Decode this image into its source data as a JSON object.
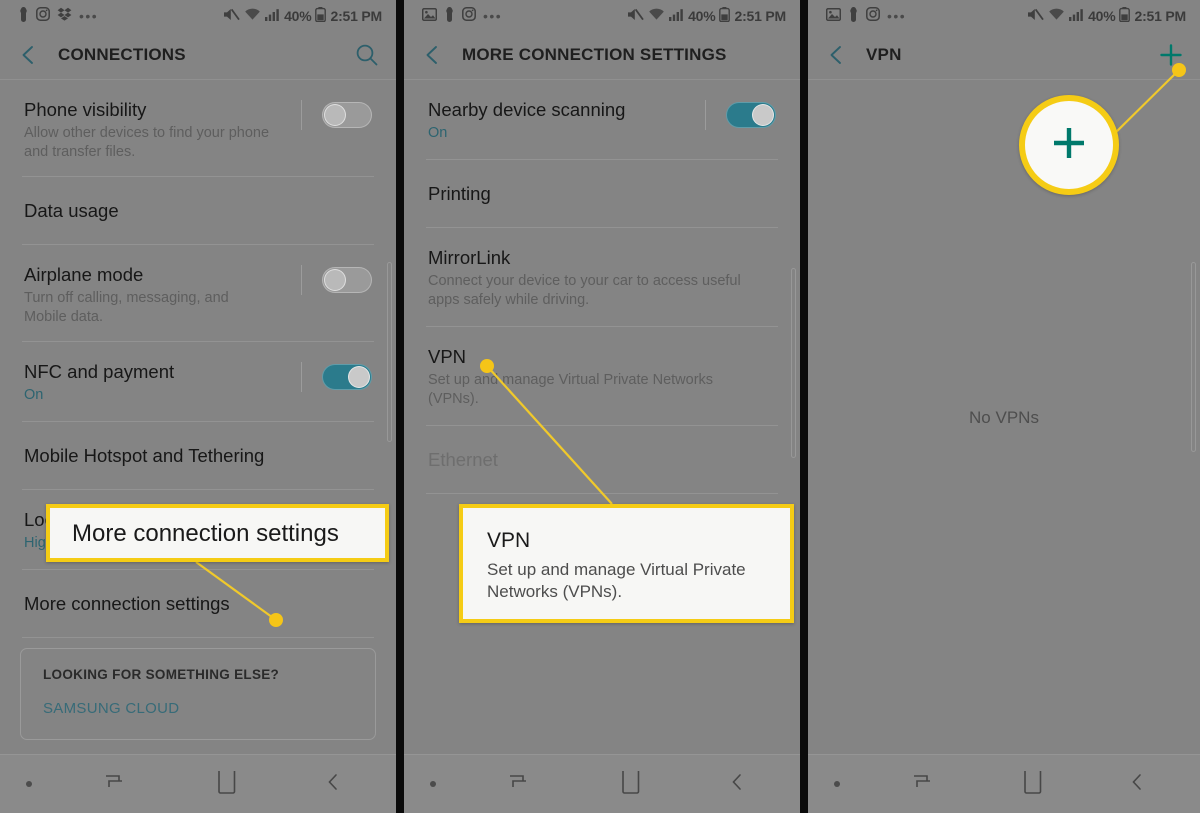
{
  "panels": [
    {
      "id": "connections",
      "statusbar": {
        "left_icons": [
          "image-icon-hidden",
          "keyhole-icon",
          "instagram-icon",
          "dropbox-icon",
          "more-dots-icon"
        ],
        "mute_icon": "mute-icon",
        "wifi_icon": "wifi-icon",
        "signal_icon": "signal-bars-icon",
        "battery_percent": "40%",
        "battery_icon": "battery-icon",
        "time": "2:51 PM"
      },
      "appbar": {
        "back_icon": "chevron-left-icon",
        "title": "CONNECTIONS",
        "action_icon": "search-icon"
      },
      "rows": [
        {
          "title": "Phone visibility",
          "sub": "Allow other devices to find your phone and transfer files.",
          "toggle": "off"
        },
        {
          "title": "Data usage",
          "sub": "",
          "toggle": "none"
        },
        {
          "title": "Airplane mode",
          "sub": "Turn off calling, messaging, and Mobile data.",
          "toggle": "off"
        },
        {
          "title": "NFC and payment",
          "sub": "On",
          "sub_state": "on",
          "toggle": "on"
        },
        {
          "title": "Mobile Hotspot and Tethering",
          "sub": "",
          "toggle": "none"
        },
        {
          "title": "Location",
          "sub": "High accuracy",
          "sub_state": "on",
          "toggle": "none"
        },
        {
          "title": "More connection settings",
          "sub": "",
          "toggle": "none"
        }
      ],
      "footer_card": {
        "title": "LOOKING FOR SOMETHING ELSE?",
        "link": "SAMSUNG CLOUD"
      }
    },
    {
      "id": "more-connection-settings",
      "statusbar": {
        "left_icons": [
          "image-icon",
          "keyhole-icon",
          "instagram-icon",
          "more-dots-icon"
        ],
        "mute_icon": "mute-icon",
        "wifi_icon": "wifi-icon",
        "signal_icon": "signal-bars-icon",
        "battery_percent": "40%",
        "battery_icon": "battery-icon",
        "time": "2:51 PM"
      },
      "appbar": {
        "back_icon": "chevron-left-icon",
        "title": "MORE CONNECTION SETTINGS",
        "action_icon": "none"
      },
      "rows": [
        {
          "title": "Nearby device scanning",
          "sub": "On",
          "sub_state": "on",
          "toggle": "on"
        },
        {
          "title": "Printing",
          "sub": "",
          "toggle": "none"
        },
        {
          "title": "MirrorLink",
          "sub": "Connect your device to your car to access useful apps safely while driving.",
          "toggle": "none"
        },
        {
          "title": "VPN",
          "sub": "Set up and manage Virtual Private Networks (VPNs).",
          "toggle": "none"
        },
        {
          "title": "Ethernet",
          "sub": "",
          "toggle": "none",
          "disabled": true
        }
      ]
    },
    {
      "id": "vpn",
      "statusbar": {
        "left_icons": [
          "image-icon",
          "keyhole-icon",
          "instagram-icon",
          "more-dots-icon"
        ],
        "mute_icon": "mute-icon",
        "wifi_icon": "wifi-icon",
        "signal_icon": "signal-bars-icon",
        "battery_percent": "40%",
        "battery_icon": "battery-icon",
        "time": "2:51 PM"
      },
      "appbar": {
        "back_icon": "chevron-left-icon",
        "title": "VPN",
        "action_icon": "plus-icon"
      },
      "empty_state": "No VPNs"
    }
  ],
  "navbar": {
    "items": [
      "nav-dot-icon",
      "recents-icon",
      "home-icon",
      "back-icon"
    ]
  },
  "callouts": {
    "more_connection_settings": {
      "label": "More connection settings"
    },
    "vpn": {
      "title": "VPN",
      "sub": "Set up and manage Virtual Private Networks (VPNs)."
    },
    "plus_circle": {
      "icon": "plus-icon"
    }
  },
  "colors": {
    "highlight": "#f5cc15",
    "accent_teal": "#00796b",
    "toggle_on": "#2b7b8c",
    "link": "#376b78",
    "panel_bg": "#848484"
  }
}
